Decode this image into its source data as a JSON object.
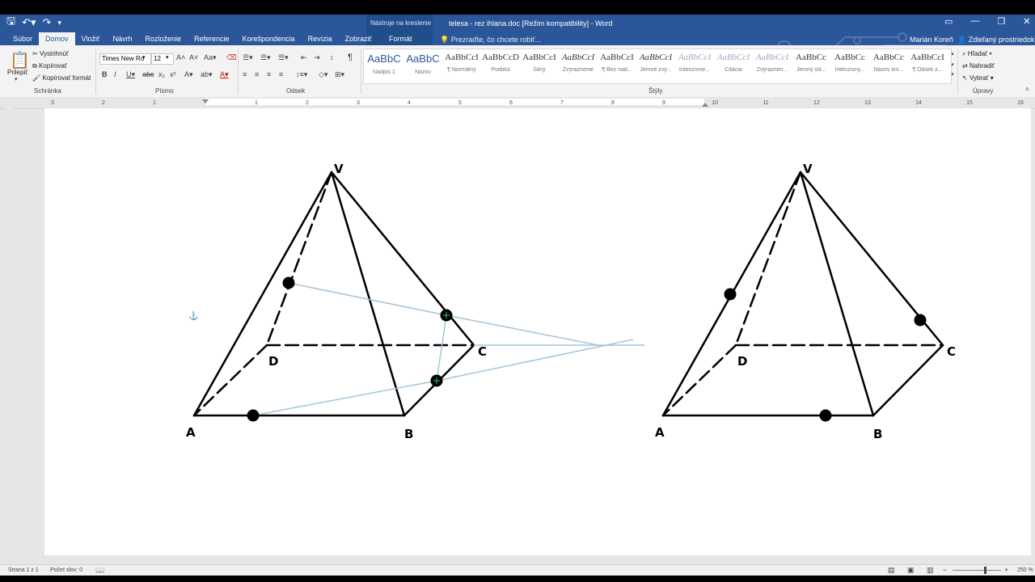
{
  "window": {
    "title": "telesa - rez ihlana.doc [Režim kompatibility] - Word",
    "context_group": "Nástroje na kreslenie",
    "context_tab": "Formát",
    "user": "Marián Koreň",
    "share": "Zdieľaný prostriedok",
    "tell_me": "Prezraďte, čo chcete robiť..."
  },
  "tabs": [
    "Súbor",
    "Domov",
    "Vložiť",
    "Návrh",
    "Rozloženie",
    "Referencie",
    "Korešpondencia",
    "Revízia",
    "Zobraziť"
  ],
  "ribbon": {
    "clipboard": {
      "paste": "Prilepiť",
      "cut": "Vystrihnúť",
      "copy": "Kopírovať",
      "format_painter": "Kopírovať formát",
      "label": "Schránka"
    },
    "font": {
      "name": "Times New Ro",
      "size": "12",
      "label": "Písmo"
    },
    "paragraph": {
      "label": "Odsek"
    },
    "styles": {
      "label": "Štýly",
      "items": [
        {
          "sample": "AaBbC",
          "name": "Nadpis 1"
        },
        {
          "sample": "AaBbC",
          "name": "Názov"
        },
        {
          "sample": "AaBbCcI",
          "name": "¶ Normálny"
        },
        {
          "sample": "AaBbCcD",
          "name": "Podtitul"
        },
        {
          "sample": "AaBbCcI",
          "name": "Silný"
        },
        {
          "sample": "AaBbCcI",
          "name": "Zvýraznenie"
        },
        {
          "sample": "AaBbCcI",
          "name": "¶ Bez riad..."
        },
        {
          "sample": "AaBbCcI",
          "name": "Jemné zvý..."
        },
        {
          "sample": "AaBbCcI",
          "name": "Intenzívne..."
        },
        {
          "sample": "AaBbCcI",
          "name": "Citácia"
        },
        {
          "sample": "AaBbCcI",
          "name": "Zvýraznen..."
        },
        {
          "sample": "AaBbCc",
          "name": "Jemný od..."
        },
        {
          "sample": "AaBbCc",
          "name": "Intenzívny..."
        },
        {
          "sample": "AaBbCc",
          "name": "Názov kni..."
        },
        {
          "sample": "AaBbCcI",
          "name": "¶ Odsek z..."
        }
      ]
    },
    "editing": {
      "find": "Hľadať",
      "replace": "Nahradiť",
      "select": "Vybrať",
      "label": "Úpravy"
    }
  },
  "ruler": {
    "labels": [
      "3",
      "2",
      "1",
      "1",
      "2",
      "3",
      "4",
      "5",
      "6",
      "7",
      "8",
      "9",
      "10",
      "11",
      "12",
      "13",
      "14",
      "15",
      "16"
    ]
  },
  "drawing": {
    "left_vertices": {
      "V": "V",
      "A": "A",
      "B": "B",
      "C": "C",
      "D": "D"
    },
    "right_vertices": {
      "V": "V",
      "A": "A",
      "B": "B",
      "C": "C",
      "D": "D"
    }
  },
  "status": {
    "page": "Strana 1 z 1",
    "words": "Počet slov: 0",
    "zoom": "250 %"
  },
  "colors": {
    "ribbon_blue": "#2b579a",
    "construction_line": "#a7c4d6",
    "point": "#000000"
  }
}
